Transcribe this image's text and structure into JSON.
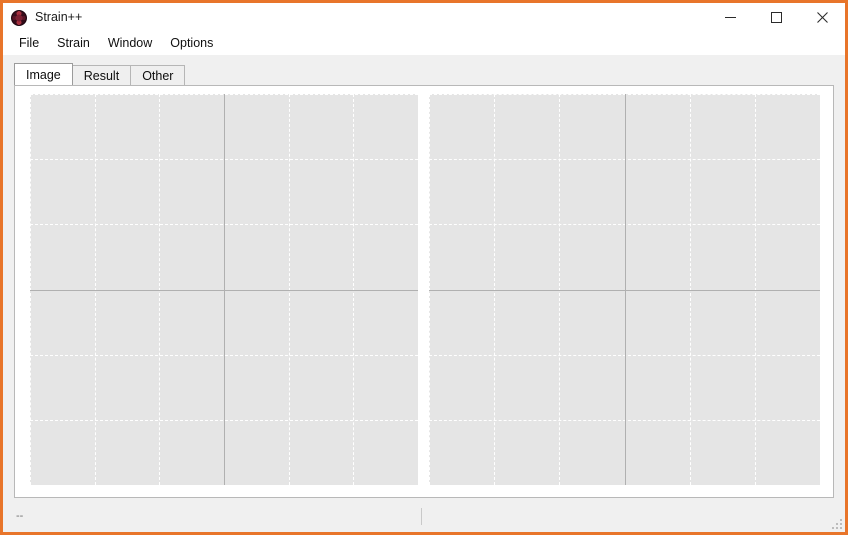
{
  "window": {
    "title": "Strain++",
    "icon": "app-logo-icon",
    "border_color": "#e8752a",
    "controls": [
      {
        "name": "minimize",
        "glyph": "minimize-icon",
        "label": "Minimize"
      },
      {
        "name": "maximize",
        "glyph": "maximize-icon",
        "label": "Maximize"
      },
      {
        "name": "close",
        "glyph": "close-icon",
        "label": "Close"
      }
    ]
  },
  "menu": {
    "items": [
      {
        "label": "File"
      },
      {
        "label": "Strain"
      },
      {
        "label": "Window"
      },
      {
        "label": "Options"
      }
    ]
  },
  "tabs": {
    "selected_index": 0,
    "items": [
      {
        "label": "Image"
      },
      {
        "label": "Result"
      },
      {
        "label": "Other"
      }
    ]
  },
  "chart_data": {
    "type": "scatter",
    "title": "",
    "subtitle": "",
    "xlabel": "",
    "ylabel": "",
    "grid": true,
    "legend": "none",
    "panels": [
      {
        "name": "image-plot-left",
        "series": [],
        "xlim": [
          -3,
          3
        ],
        "ylim": [
          -3,
          3
        ],
        "xticks": [
          -3,
          -2,
          -1,
          0,
          1,
          2,
          3
        ],
        "yticks": [
          -3,
          -2,
          -1,
          0,
          1,
          2,
          3
        ],
        "xticklabels": [
          "",
          "",
          "",
          "",
          "",
          "",
          ""
        ],
        "yticklabels": [
          "",
          "",
          "",
          "",
          "",
          "",
          ""
        ],
        "background": "#e5e5e5",
        "gridline_color": "#ffffff",
        "axisline_color": "#b0b0b0",
        "vgrid_fracs": [
          0.0,
          0.167,
          0.333,
          0.667,
          0.833,
          1.0
        ],
        "hgrid_fracs": [
          0.0,
          0.167,
          0.333,
          0.667,
          0.833,
          1.0
        ],
        "vaxis_frac": 0.5,
        "haxis_frac": 0.5
      },
      {
        "name": "image-plot-right",
        "series": [],
        "xlim": [
          -3,
          3
        ],
        "ylim": [
          -3,
          3
        ],
        "xticks": [
          -3,
          -2,
          -1,
          0,
          1,
          2,
          3
        ],
        "yticks": [
          -3,
          -2,
          -1,
          0,
          1,
          2,
          3
        ],
        "xticklabels": [
          "",
          "",
          "",
          "",
          "",
          "",
          ""
        ],
        "yticklabels": [
          "",
          "",
          "",
          "",
          "",
          "",
          ""
        ],
        "background": "#e5e5e5",
        "gridline_color": "#ffffff",
        "axisline_color": "#b0b0b0",
        "vgrid_fracs": [
          0.0,
          0.167,
          0.333,
          0.667,
          0.833,
          1.0
        ],
        "hgrid_fracs": [
          0.0,
          0.167,
          0.333,
          0.667,
          0.833,
          1.0
        ],
        "vaxis_frac": 0.5,
        "haxis_frac": 0.5
      }
    ]
  },
  "status_bar": {
    "message": "--",
    "secondary": ""
  }
}
